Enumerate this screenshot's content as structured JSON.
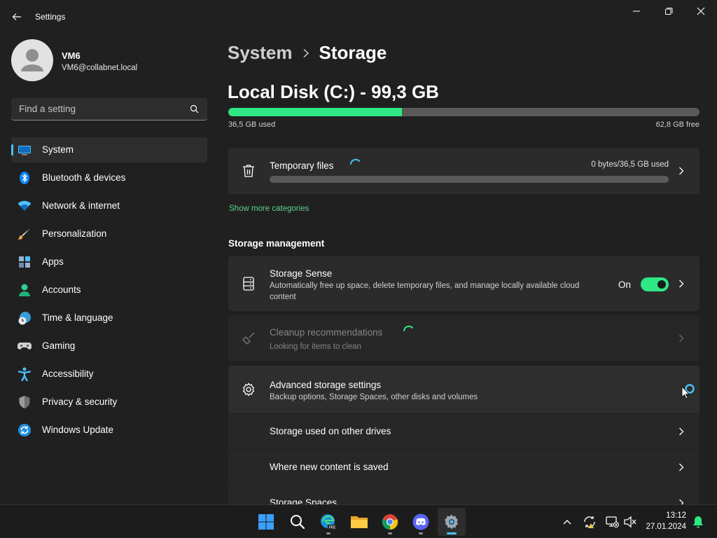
{
  "window": {
    "title": "Settings",
    "controls": [
      "minimize-icon",
      "restore-icon",
      "close-icon"
    ]
  },
  "user": {
    "name": "VM6",
    "email": "VM6@collabnet.local"
  },
  "search": {
    "placeholder": "Find a setting"
  },
  "sidebar": {
    "items": [
      {
        "label": "System",
        "icon": "system-icon",
        "active": true
      },
      {
        "label": "Bluetooth & devices",
        "icon": "bluetooth-icon"
      },
      {
        "label": "Network & internet",
        "icon": "wifi-icon"
      },
      {
        "label": "Personalization",
        "icon": "brush-icon"
      },
      {
        "label": "Apps",
        "icon": "apps-icon"
      },
      {
        "label": "Accounts",
        "icon": "person-icon"
      },
      {
        "label": "Time & language",
        "icon": "globe-clock-icon"
      },
      {
        "label": "Gaming",
        "icon": "gamepad-icon"
      },
      {
        "label": "Accessibility",
        "icon": "accessibility-icon"
      },
      {
        "label": "Privacy & security",
        "icon": "shield-icon"
      },
      {
        "label": "Windows Update",
        "icon": "update-icon"
      }
    ]
  },
  "breadcrumb": {
    "parent": "System",
    "current": "Storage"
  },
  "disk": {
    "title": "Local Disk (C:) - 99,3 GB",
    "used_label": "36,5 GB used",
    "free_label": "62,8 GB free",
    "used_fraction": 0.368
  },
  "temp_files": {
    "title": "Temporary files",
    "usage": "0 bytes/36,5 GB used"
  },
  "show_more": "Show more categories",
  "storage_management": {
    "heading": "Storage management",
    "storage_sense": {
      "title": "Storage Sense",
      "desc": "Automatically free up space, delete temporary files, and manage locally available cloud content",
      "state": "On"
    },
    "cleanup": {
      "title": "Cleanup recommendations",
      "desc": "Looking for items to clean"
    },
    "advanced": {
      "title": "Advanced storage settings",
      "desc": "Backup options, Storage Spaces, other disks and volumes",
      "sub_items": [
        "Storage used on other drives",
        "Where new content is saved",
        "Storage Spaces"
      ]
    }
  },
  "taskbar": {
    "apps": [
      "windows-start-icon",
      "search-icon",
      "edge-pre-icon",
      "file-explorer-icon",
      "chrome-icon",
      "discord-icon",
      "settings-icon"
    ],
    "time": "13:12",
    "date": "27.01.2024"
  },
  "colors": {
    "accent": "#4cc2ff",
    "storage_green": "#2ee884",
    "link_green": "#5ad38b"
  }
}
